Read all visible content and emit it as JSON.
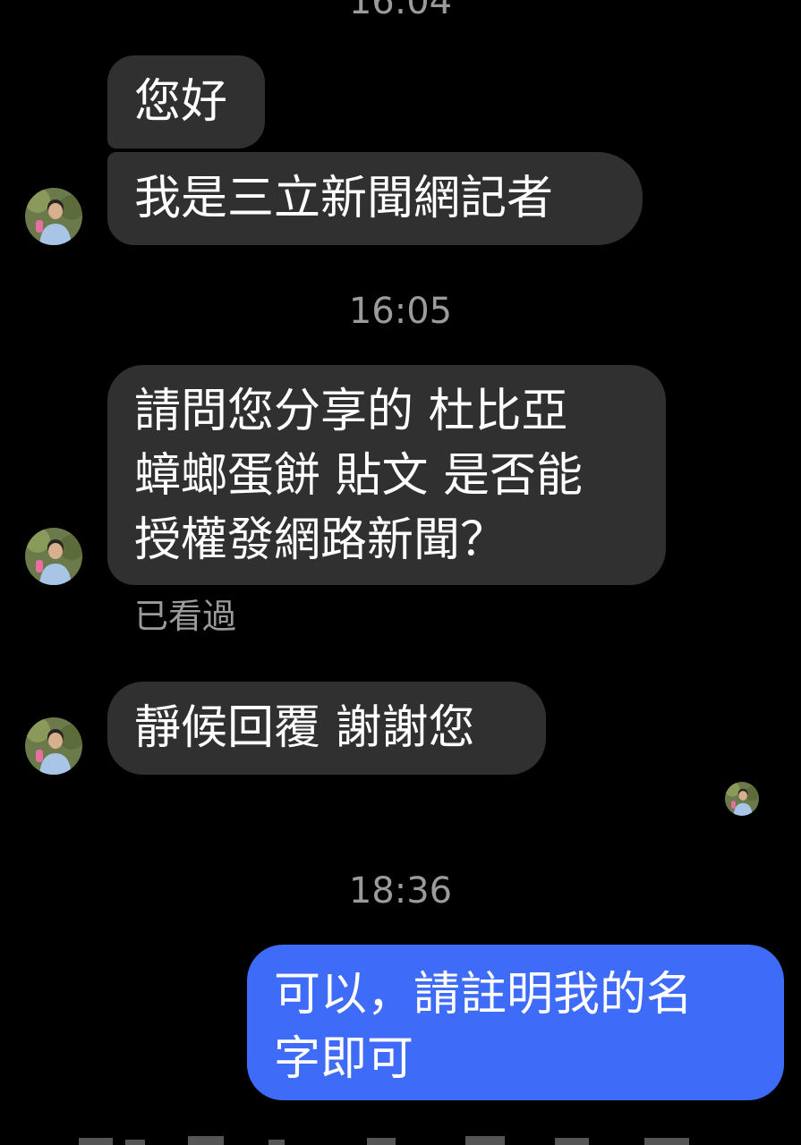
{
  "conversation": {
    "timestamps": [
      "16:04",
      "16:05",
      "18:36"
    ],
    "messages": [
      {
        "text": "您好",
        "direction": "incoming"
      },
      {
        "text": "我是三立新聞網記者",
        "direction": "incoming"
      },
      {
        "text": "請問您分享的 杜比亞\n蟑螂蛋餅 貼文 是否能\n授權發網路新聞？",
        "direction": "incoming"
      },
      {
        "text": "靜候回覆 謝謝您",
        "direction": "incoming"
      },
      {
        "text": "可以，請註明我的名\n字即可",
        "direction": "outgoing"
      }
    ],
    "seen_label": "已看過"
  },
  "colors": {
    "background": "#000000",
    "incoming_bubble": "#303030",
    "outgoing_bubble": "#3e6bf7",
    "timestamp_text": "#9b9b9b"
  },
  "icons": {
    "contact_avatar": "avatar-icon",
    "read_receipt": "read-receipt-avatar-icon"
  }
}
